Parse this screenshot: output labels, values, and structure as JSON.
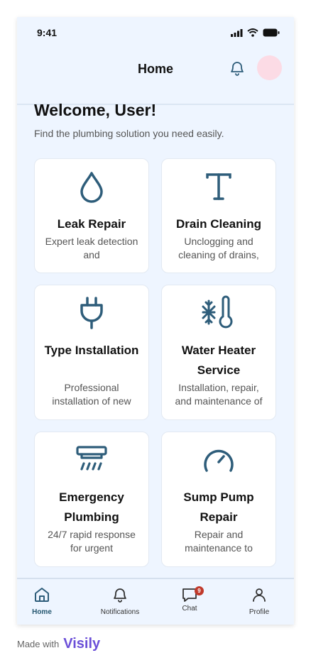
{
  "status_bar": {
    "time": "9:41"
  },
  "header": {
    "title": "Home"
  },
  "main": {
    "welcome": "Welcome, User!",
    "subtitle": "Find the plumbing solution you need easily.",
    "cards": [
      {
        "title": "Leak Repair",
        "desc": "Expert leak detection and",
        "icon": "water-drop-icon"
      },
      {
        "title": "Drain Cleaning",
        "desc": "Unclogging and cleaning of drains,",
        "icon": "letter-t-icon"
      },
      {
        "title": "Type Installation",
        "desc": "Professional installation of new",
        "icon": "plug-icon"
      },
      {
        "title": "Water Heater Service",
        "desc": "Installation, repair, and maintenance of",
        "icon": "thermometer-snowflake-icon"
      },
      {
        "title": "Emergency Plumbing",
        "desc": "24/7 rapid response for urgent",
        "icon": "air-conditioner-icon"
      },
      {
        "title": "Sump Pump Repair",
        "desc": "Repair and maintenance to",
        "icon": "gauge-icon"
      }
    ]
  },
  "nav": {
    "items": [
      {
        "label": "Home",
        "icon": "home-icon"
      },
      {
        "label": "Notifications",
        "icon": "bell-icon"
      },
      {
        "label": "Chat",
        "icon": "chat-icon",
        "badge": "9"
      },
      {
        "label": "Profile",
        "icon": "user-icon"
      }
    ]
  },
  "footer": {
    "made_with": "Made with",
    "brand": "Visily"
  },
  "colors": {
    "accent": "#2e5d7a",
    "background": "#eef5ff",
    "avatar": "#fcdbe5",
    "badge": "#c0392b",
    "brand": "#6b4fd8"
  }
}
